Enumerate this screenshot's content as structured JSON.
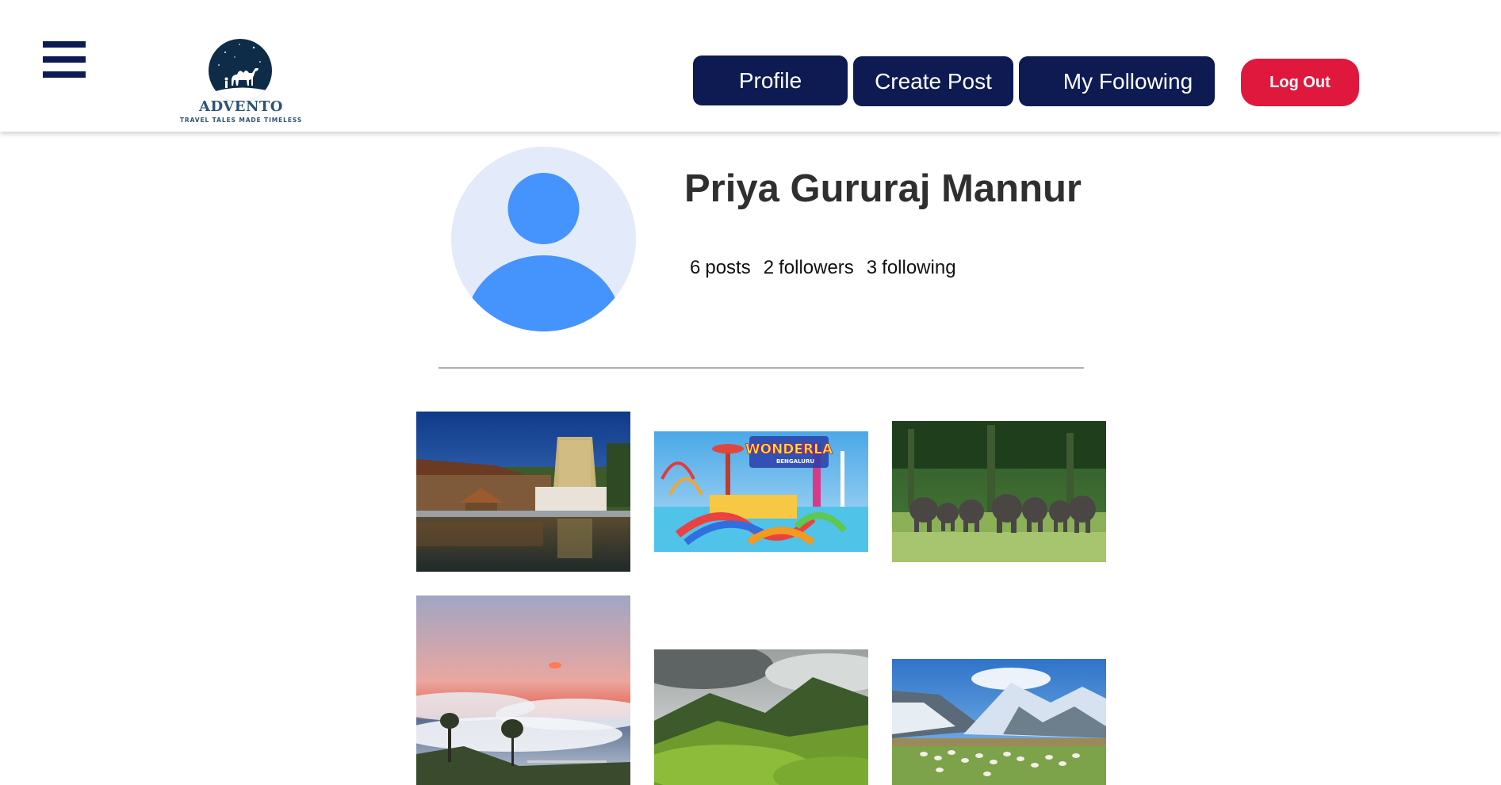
{
  "header": {
    "menu_icon": "hamburger-menu-icon",
    "logo": {
      "name": "ADVENTO",
      "tagline": "TRAVEL TALES MADE TIMELESS",
      "icon": "camel-moon-logo"
    },
    "nav": {
      "profile_label": "Profile",
      "create_post_label": "Create Post",
      "my_following_label": "My Following"
    },
    "logout_label": "Log Out"
  },
  "profile": {
    "name": "Priya Gururaj Mannur",
    "avatar_icon": "default-user-avatar",
    "stats": {
      "posts_count": "6",
      "posts_label": "posts",
      "followers_count": "2",
      "followers_label": "followers",
      "following_count": "3",
      "following_label": "following"
    }
  },
  "posts": [
    {
      "image": "temple-pond-thumbnail"
    },
    {
      "image": "wonderla-water-park-thumbnail",
      "overlay_text": "WONDERLA",
      "overlay_subtext": "BENGALURU"
    },
    {
      "image": "elephant-herd-thumbnail"
    },
    {
      "image": "sunset-above-clouds-thumbnail"
    },
    {
      "image": "green-hills-thumbnail"
    },
    {
      "image": "snowy-mountains-sheep-thumbnail"
    }
  ],
  "colors": {
    "navy": "#0d1b52",
    "logout_red": "#e1183e",
    "avatar_bg": "#e3ebfb",
    "avatar_fg": "#4593fc",
    "divider": "#b0b0b0"
  }
}
